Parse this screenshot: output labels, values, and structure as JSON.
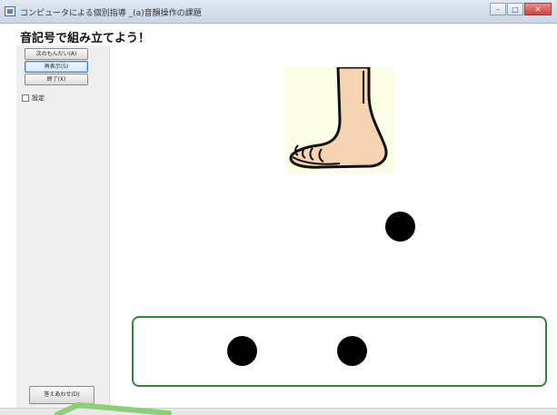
{
  "window": {
    "title": "コンピュータによる個別指導 _(a)音韻操作の課題",
    "minimize_glyph": "–",
    "maximize_glyph": "□",
    "close_glyph": "✕"
  },
  "page": {
    "title": "音記号で組み立てよう！"
  },
  "sidebar": {
    "next_label": "次のもんだい(A)",
    "replay_label": "再表示(S)",
    "exit_label": "終了(X)",
    "settings_label": "設定",
    "answer_label": "答えあわせ(D)"
  },
  "main": {
    "picture_icon": "foot-icon",
    "free_dots": 1,
    "answer_dots": 2,
    "answer_box_color": "#2f8a2f",
    "dot_color": "#000000"
  }
}
